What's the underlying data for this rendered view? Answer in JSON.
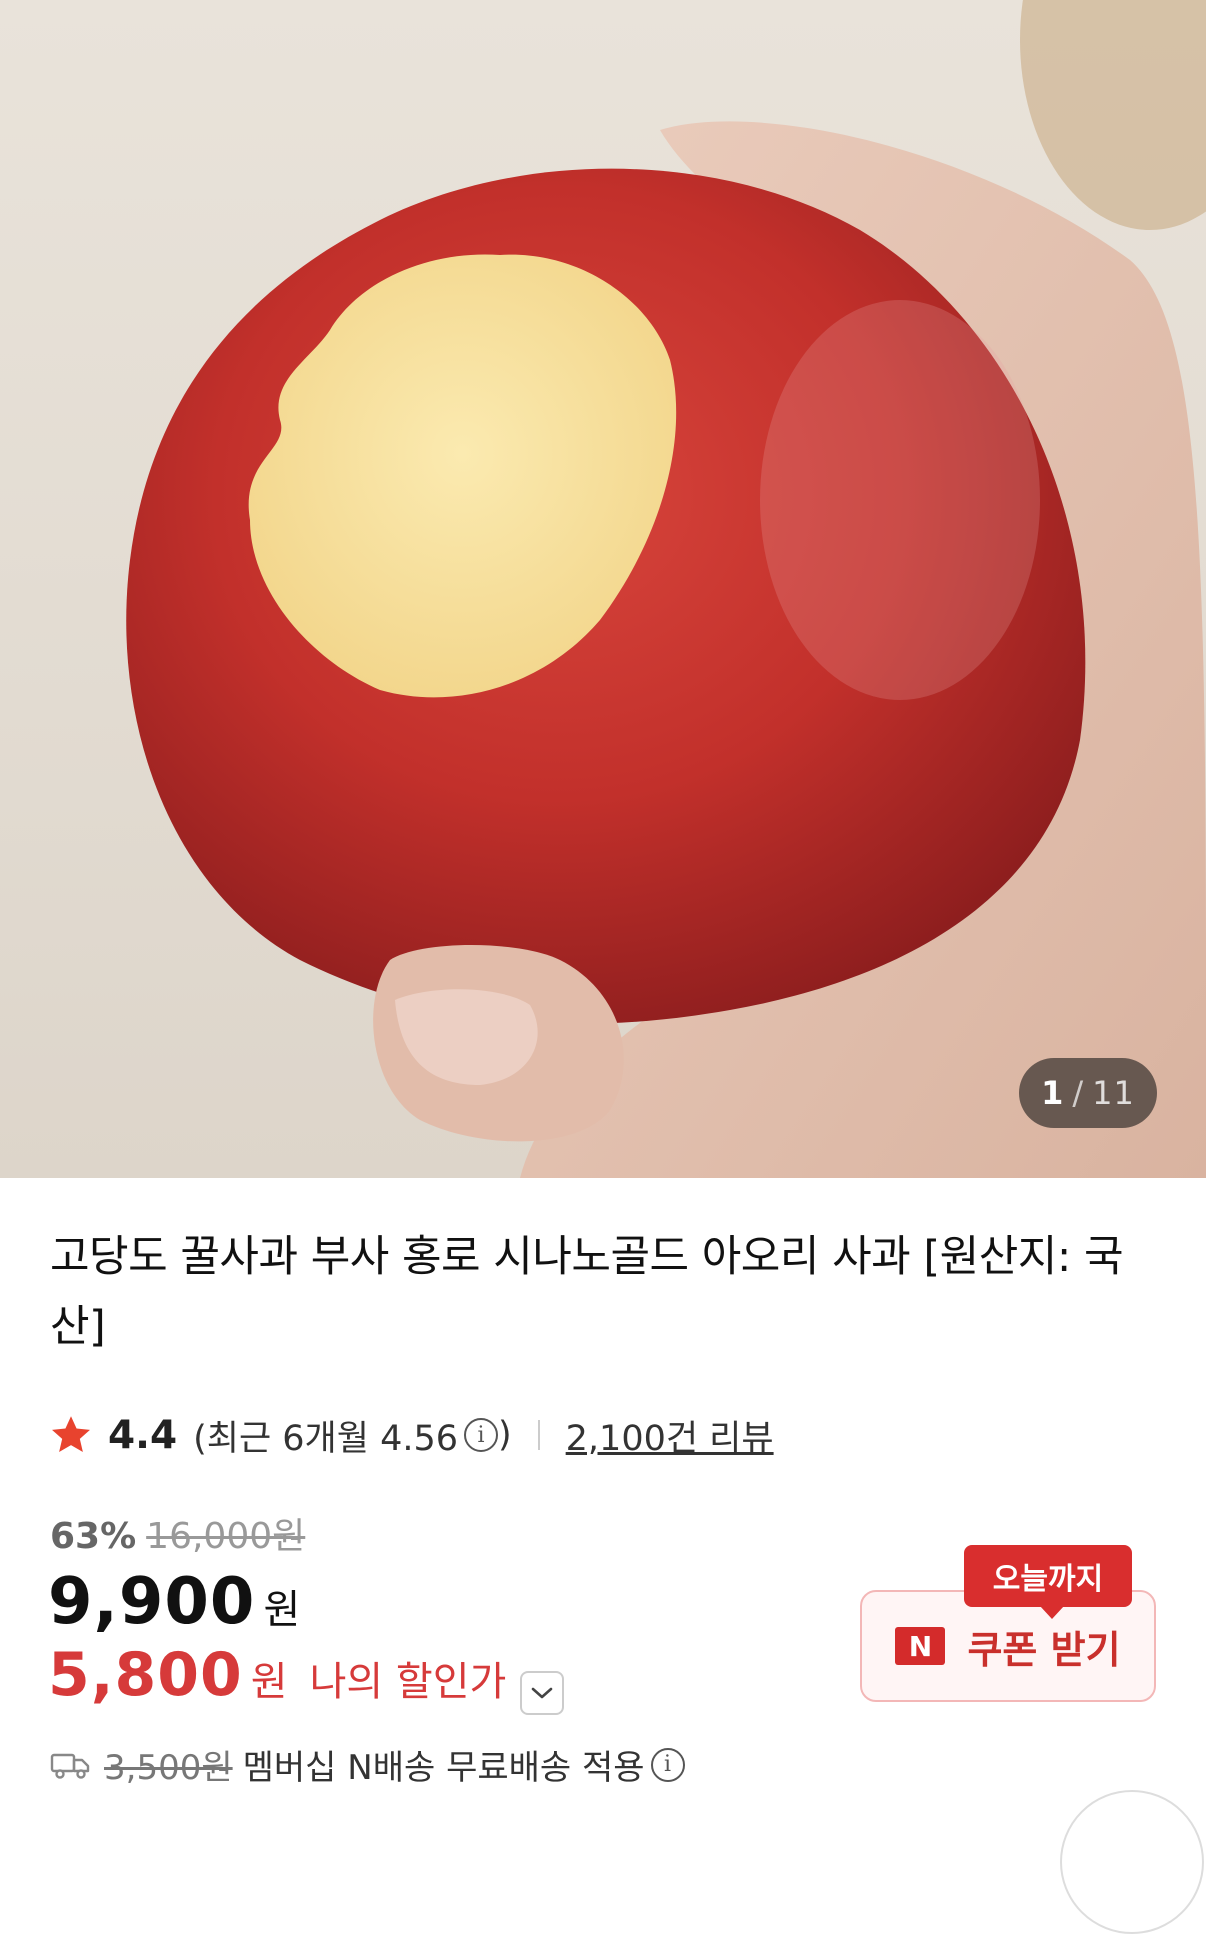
{
  "gallery": {
    "current": "1",
    "separator": "/",
    "total": "11",
    "image_alt_icon": "product-photo-apple"
  },
  "product": {
    "title": "고당도 꿀사과 부사 홍로 시나노골드 아오리 사과 [원산지: 국산]"
  },
  "rating": {
    "score": "4.4",
    "recent_text": "(최근 6개월 4.56",
    "recent_close": ")",
    "review_link": "2,100건 리뷰",
    "star_color": "#e8432e"
  },
  "price": {
    "discount_rate": "63%",
    "original": "16,000원",
    "sale": "9,900",
    "currency": "원",
    "my_price": "5,800",
    "my_currency": "원",
    "my_label": "나의 할인가"
  },
  "delivery": {
    "original_fee": "3,500원",
    "text": "멤버십 N배송 무료배송 적용"
  },
  "coupon": {
    "tag": "오늘까지",
    "logo": "N",
    "label": "쿠폰 받기",
    "accent": "#d92e2e"
  }
}
